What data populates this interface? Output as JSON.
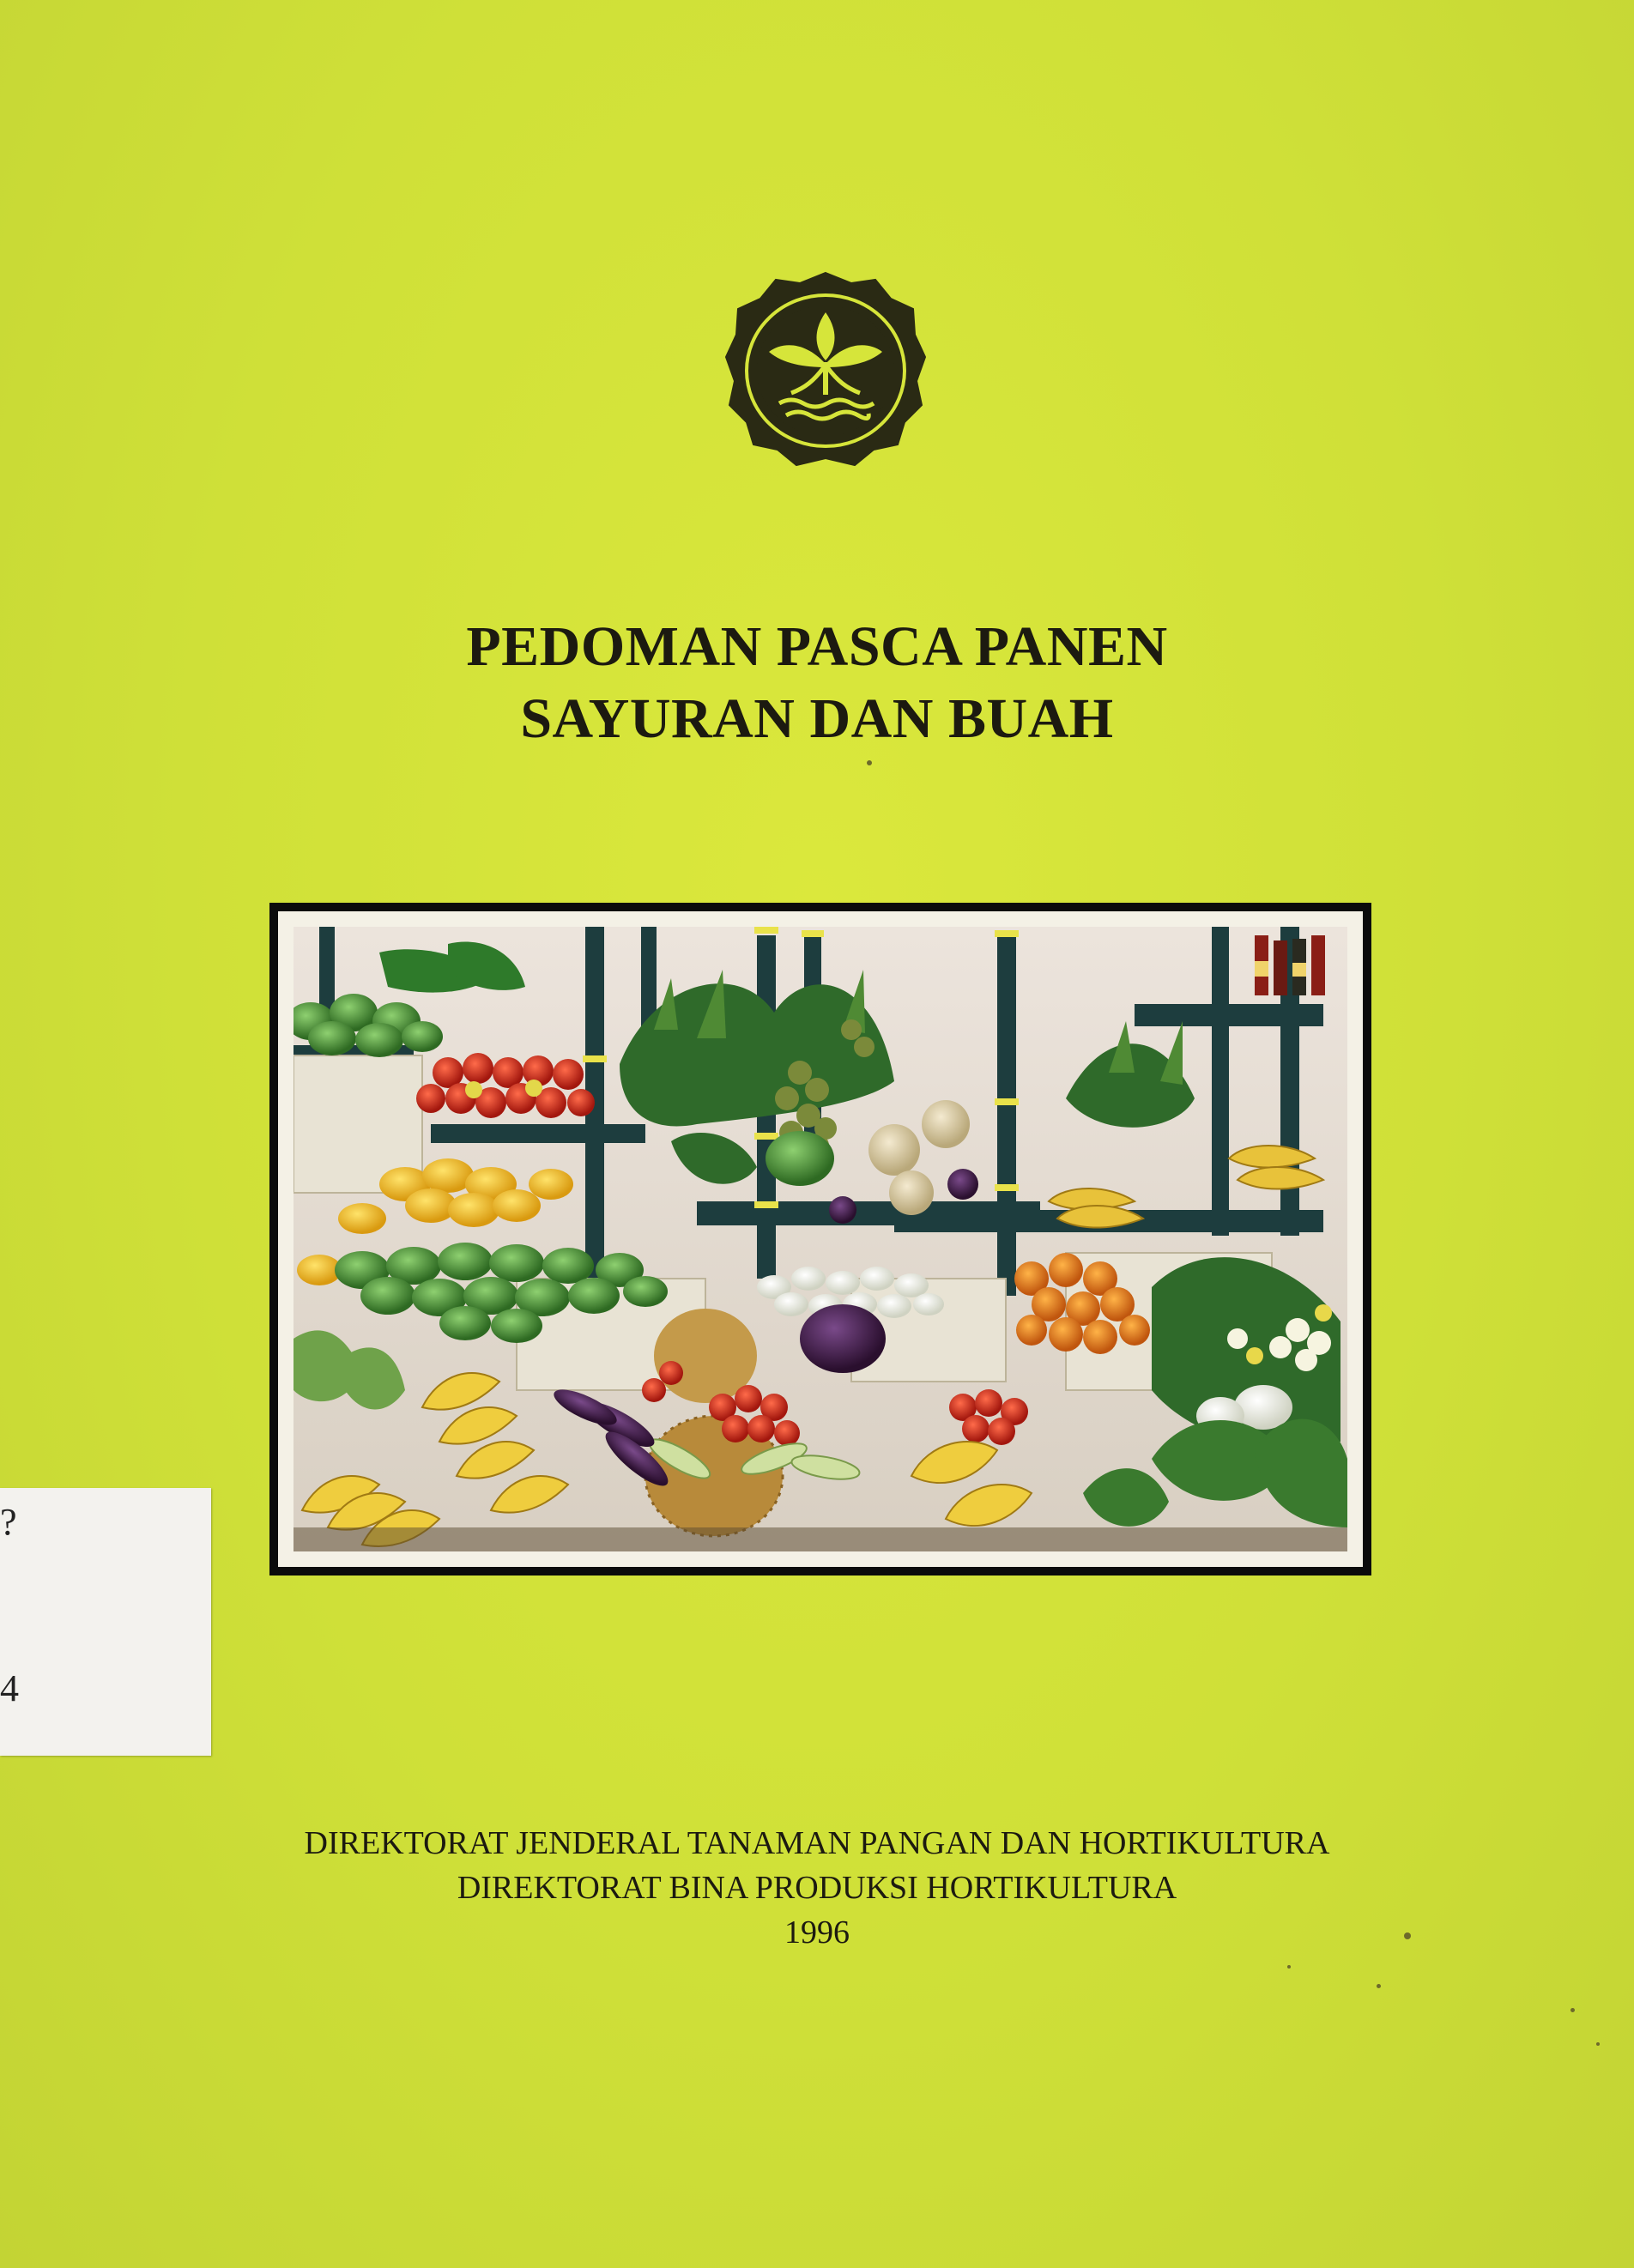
{
  "cover": {
    "background_color": "#d6e53a",
    "emblem": "ministry-of-agriculture-emblem",
    "title_line1": "PEDOMAN PASCA PANEN",
    "title_line2": "SAYURAN DAN BUAH",
    "photo": "fruit-and-vegetable-display-photo",
    "publisher_line1": "DIREKTORAT JENDERAL TANAMAN PANGAN DAN HORTIKULTURA",
    "publisher_line2": "DIREKTORAT BINA PRODUKSI HORTIKULTURA",
    "year": "1996"
  },
  "library_label": {
    "line1": "?",
    "line2": "",
    "line3": "4"
  }
}
